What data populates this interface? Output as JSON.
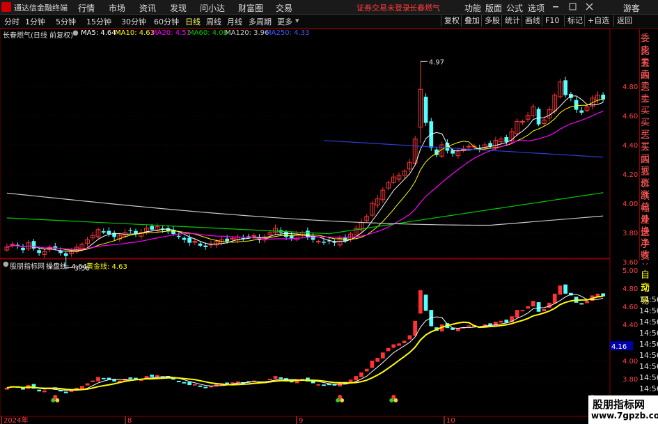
{
  "menubar": {
    "title": "通达信金融终端",
    "menus": [
      "行情",
      "市场",
      "资讯",
      "发现",
      "问小达",
      "财富圈",
      "交易"
    ],
    "status": "证券交易未登录",
    "stock": "长春燃气",
    "right_menus": [
      "功能",
      "版面",
      "公式",
      "选项"
    ],
    "guest": "游客",
    "window_controls": [
      "minimize-icon",
      "maximize-icon",
      "close-icon"
    ]
  },
  "toolbar": {
    "periods": [
      "分时",
      "1分钟",
      "5分钟",
      "15分钟",
      "30分钟",
      "60分钟",
      "日线",
      "周线",
      "月线",
      "多周期",
      "更多"
    ],
    "active_period": "日线",
    "buttons": [
      "复权",
      "叠加",
      "多股",
      "统计",
      "画线",
      "F10",
      "标记",
      "+自选",
      "返回"
    ]
  },
  "info": {
    "name": "长春燃气(日线 前复权)",
    "ma5": "MA5: 4.64",
    "ma10": "MA10: 4.63",
    "ma20": "MA20: 4.51",
    "ma60": "MA60: 4.08",
    "ma120": "MA120: 3.96",
    "ma250": "MA250: 4.33"
  },
  "indicator": {
    "name": "股朋指标网",
    "line1": "操盘线: 4.64",
    "line2": "黄金线: 4.63"
  },
  "annotations": {
    "high": "4.97",
    "low": "3.56"
  },
  "price_axis": [
    "4.80",
    "4.60",
    "4.40",
    "4.20",
    "4.00",
    "3.80",
    "3.60"
  ],
  "ind_axis": [
    "5.00",
    "4.80",
    "4.60",
    "4.40",
    "4.16",
    "4.00",
    "3.80"
  ],
  "ind_current": "4.16",
  "date_labels": [
    "2024年",
    "8",
    "9",
    "10"
  ],
  "right_panel": {
    "top": [
      "委比",
      "卖五",
      "卖四",
      "卖三",
      "卖二",
      "卖一",
      "买一",
      "买二",
      "买三",
      "买四",
      "买五",
      "现价",
      "涨跌",
      "涨幅",
      "总量",
      "外盘",
      "换手",
      "净资",
      "收益"
    ],
    "bottom": [
      "自动",
      "交易"
    ],
    "times": [
      "14:56",
      "14:56",
      "14:56",
      "14:56",
      "14:56",
      "14:56",
      "14:56",
      "14:56",
      "14:56"
    ]
  },
  "watermark": {
    "line1": "股朋指标网",
    "line2": "www.7gpzb.com"
  },
  "colors": {
    "up": "#ff3333",
    "down": "#54ffff",
    "ma5": "#ffffff",
    "ma10": "#ffff00",
    "ma20": "#ff00ff",
    "ma60": "#00cc00",
    "ma120": "#c8c8c8",
    "ma250": "#2b3fd8",
    "axis": "#ff4040"
  }
}
